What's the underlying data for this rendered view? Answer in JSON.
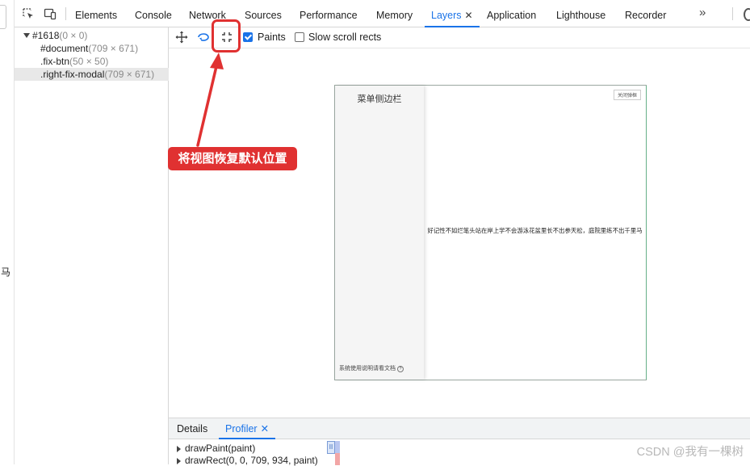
{
  "page_sliver": {
    "char": "马"
  },
  "devtools": {
    "tabs": [
      {
        "label": "Elements"
      },
      {
        "label": "Console"
      },
      {
        "label": "Network"
      },
      {
        "label": "Sources"
      },
      {
        "label": "Performance"
      },
      {
        "label": "Memory"
      },
      {
        "label": "Layers",
        "active": true,
        "close": "✕"
      },
      {
        "label": "Application"
      },
      {
        "label": "Lighthouse"
      },
      {
        "label": "Recorder"
      }
    ],
    "more": "»"
  },
  "layer_tree": {
    "root": {
      "name": "#1618",
      "dims": "(0 × 0)"
    },
    "children": [
      {
        "name": "#document",
        "dims": "(709 × 671)"
      },
      {
        "name": ".fix-btn",
        "dims": "(50 × 50)"
      },
      {
        "name": ".right-fix-modal",
        "dims": "(709 × 671)",
        "selected": true
      }
    ]
  },
  "layers_toolbar": {
    "paints_label": "Paints",
    "paints_checked": true,
    "slow_scroll_label": "Slow scroll rects",
    "slow_scroll_checked": false
  },
  "viewport": {
    "side_title": "菜单侧边栏",
    "close_button": "关闭弹框",
    "modal_text": "好记性不如烂笔头站在岸上学不会游泳花盆里长不出参天松，庭院里练不出千里马",
    "footer_text": "系统使用说明请看文档",
    "footer_icon": "?"
  },
  "annotation": {
    "callout": "将视图恢复默认位置",
    "color": "#e03131"
  },
  "drawer": {
    "tabs": [
      {
        "label": "Details"
      },
      {
        "label": "Profiler",
        "active": true,
        "close": "✕"
      }
    ],
    "rows": [
      {
        "text": "drawPaint(paint)"
      },
      {
        "text": "drawRect(0, 0, 709, 934, paint)"
      }
    ],
    "pause_glyph": "II"
  },
  "watermark": "CSDN @我有一棵树",
  "colors": {
    "accent": "#1a73e8",
    "annotation_red": "#e03131"
  }
}
